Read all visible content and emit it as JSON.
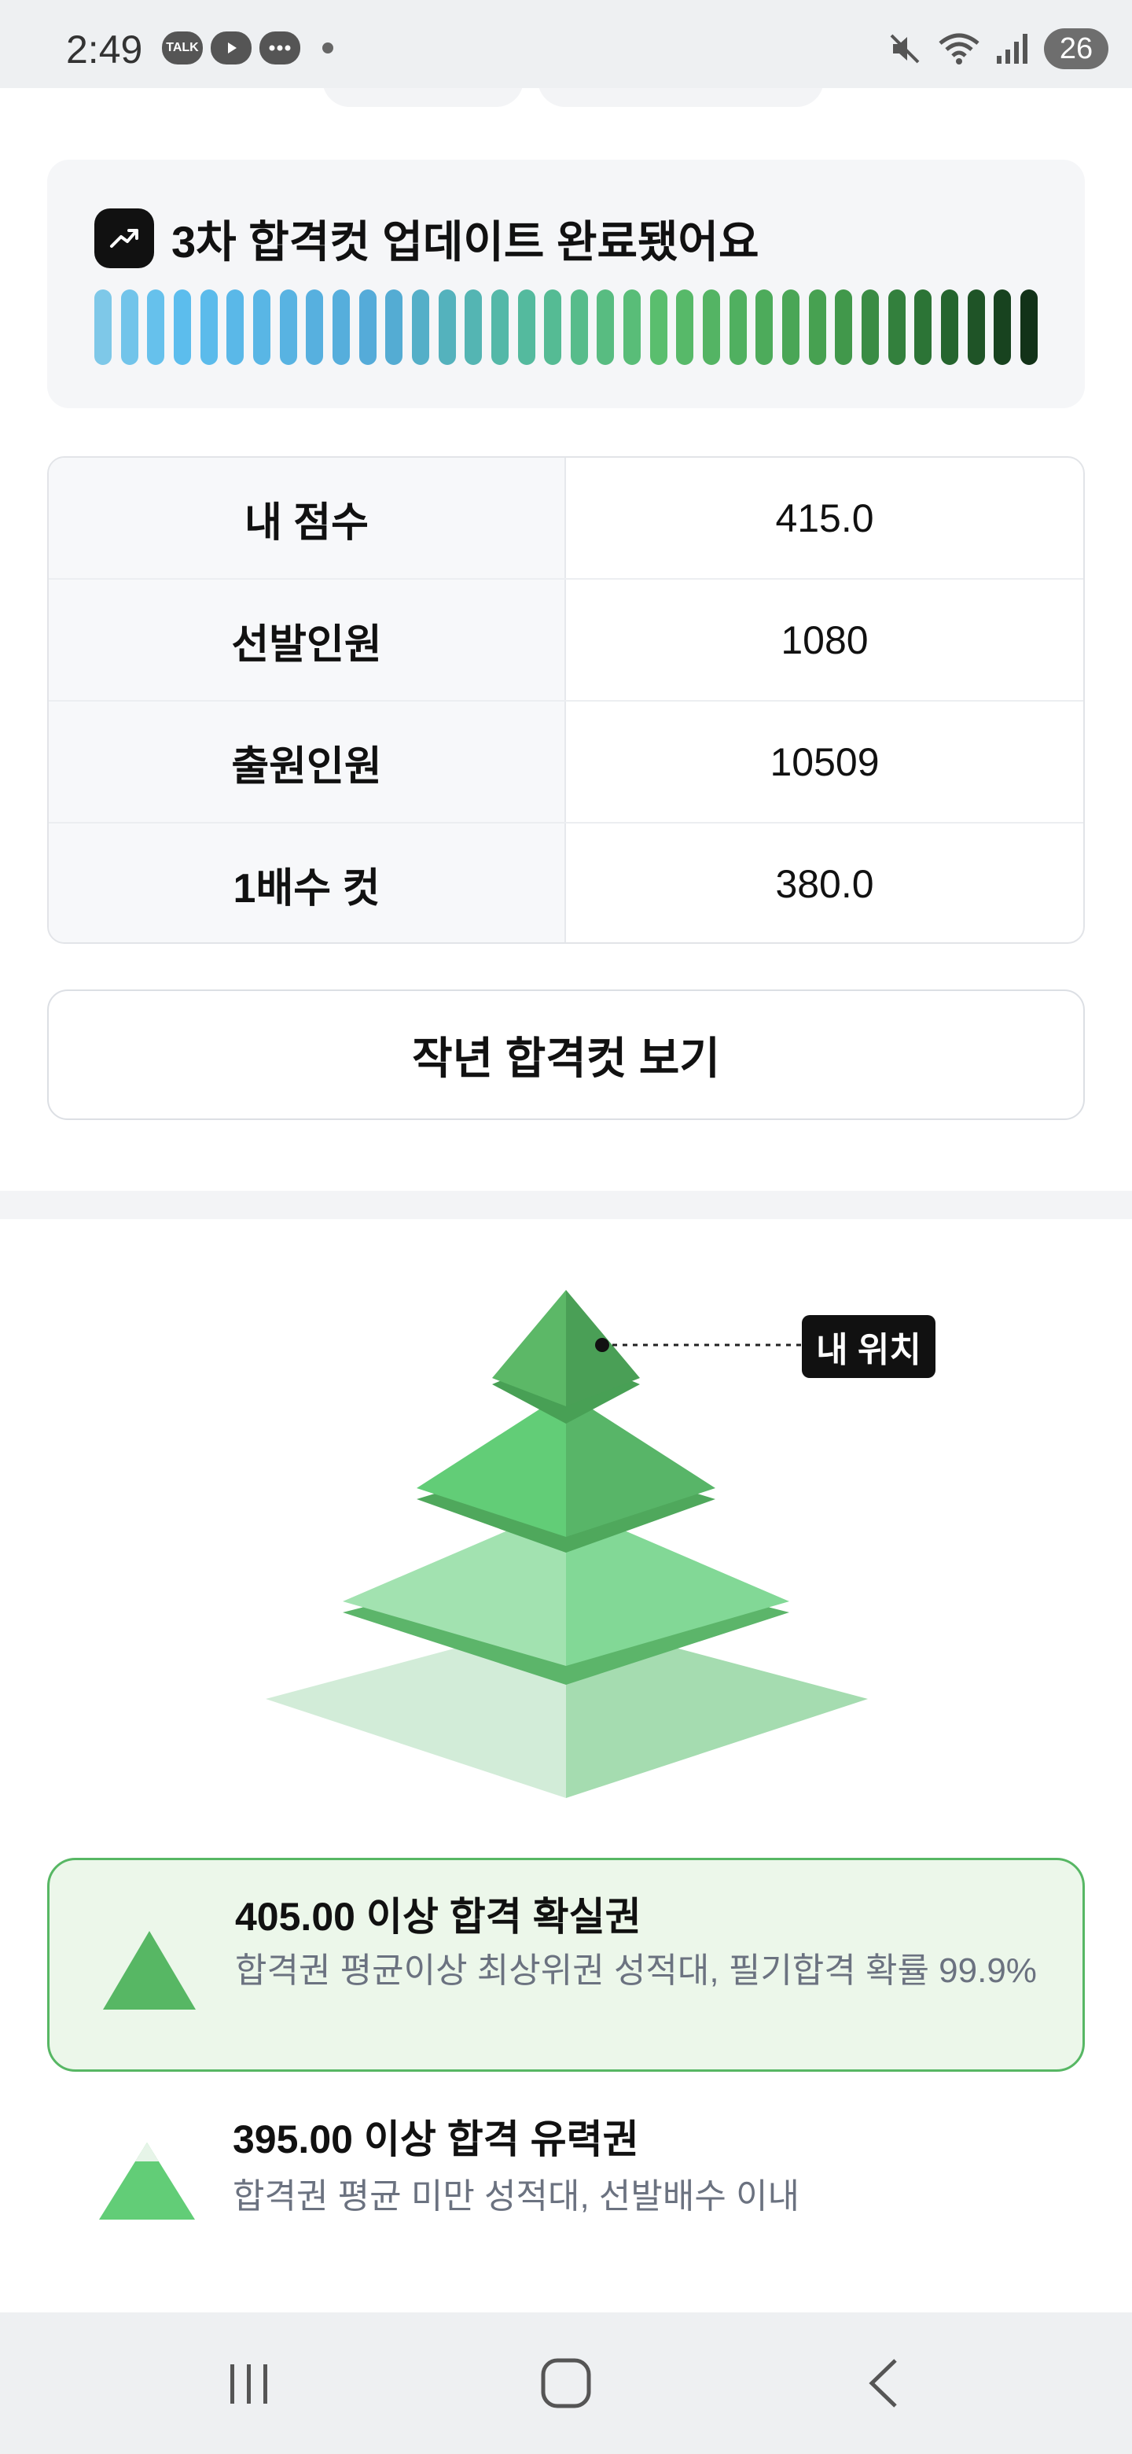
{
  "status_bar": {
    "time": "2:49",
    "notification_icons": [
      "talk-icon",
      "youtube-icon",
      "chat-icon"
    ],
    "talk_label": "TALK",
    "battery": "26"
  },
  "banner": {
    "title": "3차 합격컷 업데이트 완료됐어요",
    "icon": "trending-up-icon"
  },
  "stats": [
    {
      "label": "내 점수",
      "value": "415.0"
    },
    {
      "label": "선발인원",
      "value": "1080"
    },
    {
      "label": "출원인원",
      "value": "10509"
    },
    {
      "label": "1배수 컷",
      "value": "380.0"
    }
  ],
  "last_year_button": "작년 합격컷 보기",
  "pyramid": {
    "my_position_label": "내 위치",
    "colors": {
      "top": "#4fa85c",
      "second": "#5cc46e",
      "third": "#8ad99a",
      "base": "#c8ead0"
    }
  },
  "tiers": [
    {
      "title": "405.00 이상 합격 확실권",
      "description": "합격권 평균이상 최상위권 성적대, 필기합격 확률 99.9%",
      "highlighted": true
    },
    {
      "title": "395.00 이상 합격 유력권",
      "description": "합격권 평균 미만 성적대, 선발배수 이내",
      "highlighted": false
    }
  ],
  "accent_color": "#57b764"
}
